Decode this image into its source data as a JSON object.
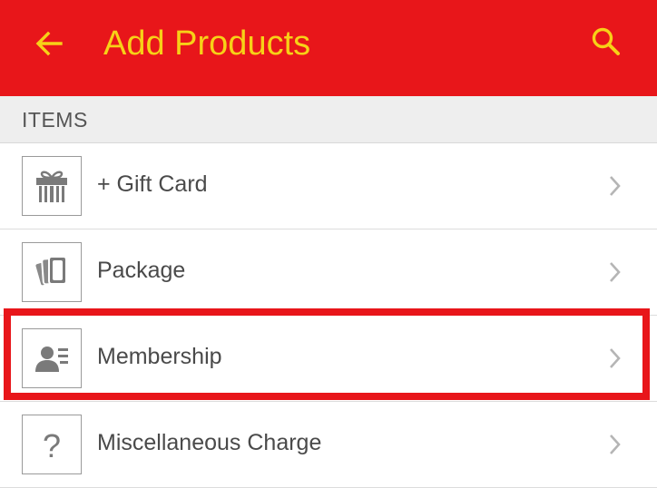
{
  "header": {
    "back_icon": "arrow-left-icon",
    "title": "Add Products",
    "search_icon": "search-icon",
    "background": "#e8161a",
    "foreground": "#f7d117"
  },
  "section": {
    "title": "ITEMS"
  },
  "items": [
    {
      "label": "+ Gift Card",
      "icon": "gift-icon"
    },
    {
      "label": "Package",
      "icon": "cards-icon"
    },
    {
      "label": "Membership",
      "icon": "member-card-icon",
      "highlighted": true
    },
    {
      "label": "Miscellaneous Charge",
      "icon": "question-mark-icon"
    }
  ],
  "highlight_color": "#e8161a"
}
